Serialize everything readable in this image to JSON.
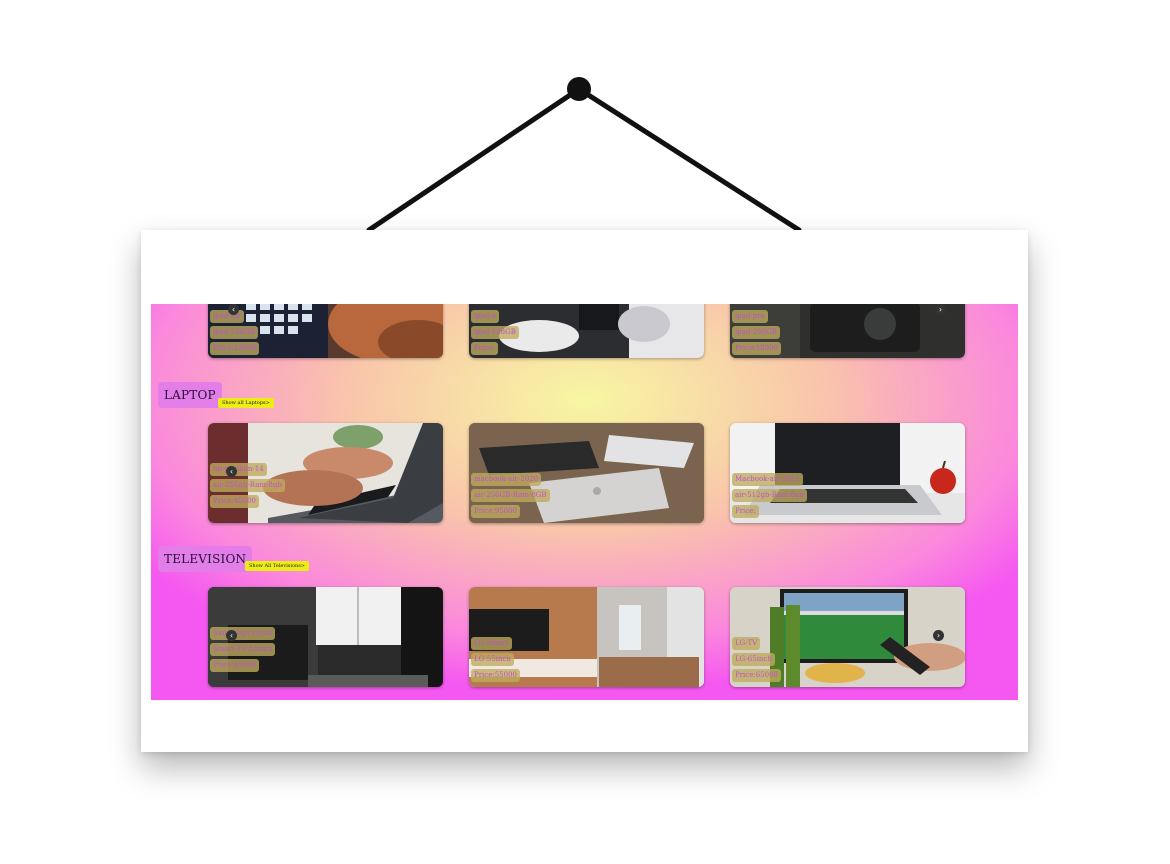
{
  "top_row": {
    "cards": [
      {
        "tags": [
          "ipad-air",
          "ipad-256GB",
          "Price:12000"
        ]
      },
      {
        "tags": [
          "ipad-a",
          "ipad-128GB",
          "Price:"
        ]
      },
      {
        "tags": [
          "ipad-pro",
          "ipad-256GB",
          "Price:18000"
        ]
      }
    ]
  },
  "laptop": {
    "title": "LAPTOP",
    "show_all": "Show all Laptops>",
    "cards": [
      {
        "tags": [
          "hp-pavilion-14",
          "air-256gb-Ram-8gb",
          "Price:45000"
        ]
      },
      {
        "tags": [
          "macbook-air-2020",
          "air-256GB-Ram-8GB",
          "Price:95000"
        ]
      },
      {
        "tags": [
          "Macbook-air-2021",
          "air-512gb-Ram-8gb",
          "Price:"
        ]
      }
    ]
  },
  "television": {
    "title": "TELEVISION",
    "show_all": "Show All Televisions>",
    "cards": [
      {
        "tags": [
          "Samsung-crystal",
          "Smart-TV-43inch",
          "Price:45000"
        ]
      },
      {
        "tags": [
          "LG-Smart",
          "LG-55inch",
          "Price:55000"
        ]
      },
      {
        "tags": [
          "LG-TV",
          "LG-65inch",
          "Price:65000"
        ]
      }
    ]
  },
  "arrows": {
    "prev": "‹",
    "next": "›"
  }
}
